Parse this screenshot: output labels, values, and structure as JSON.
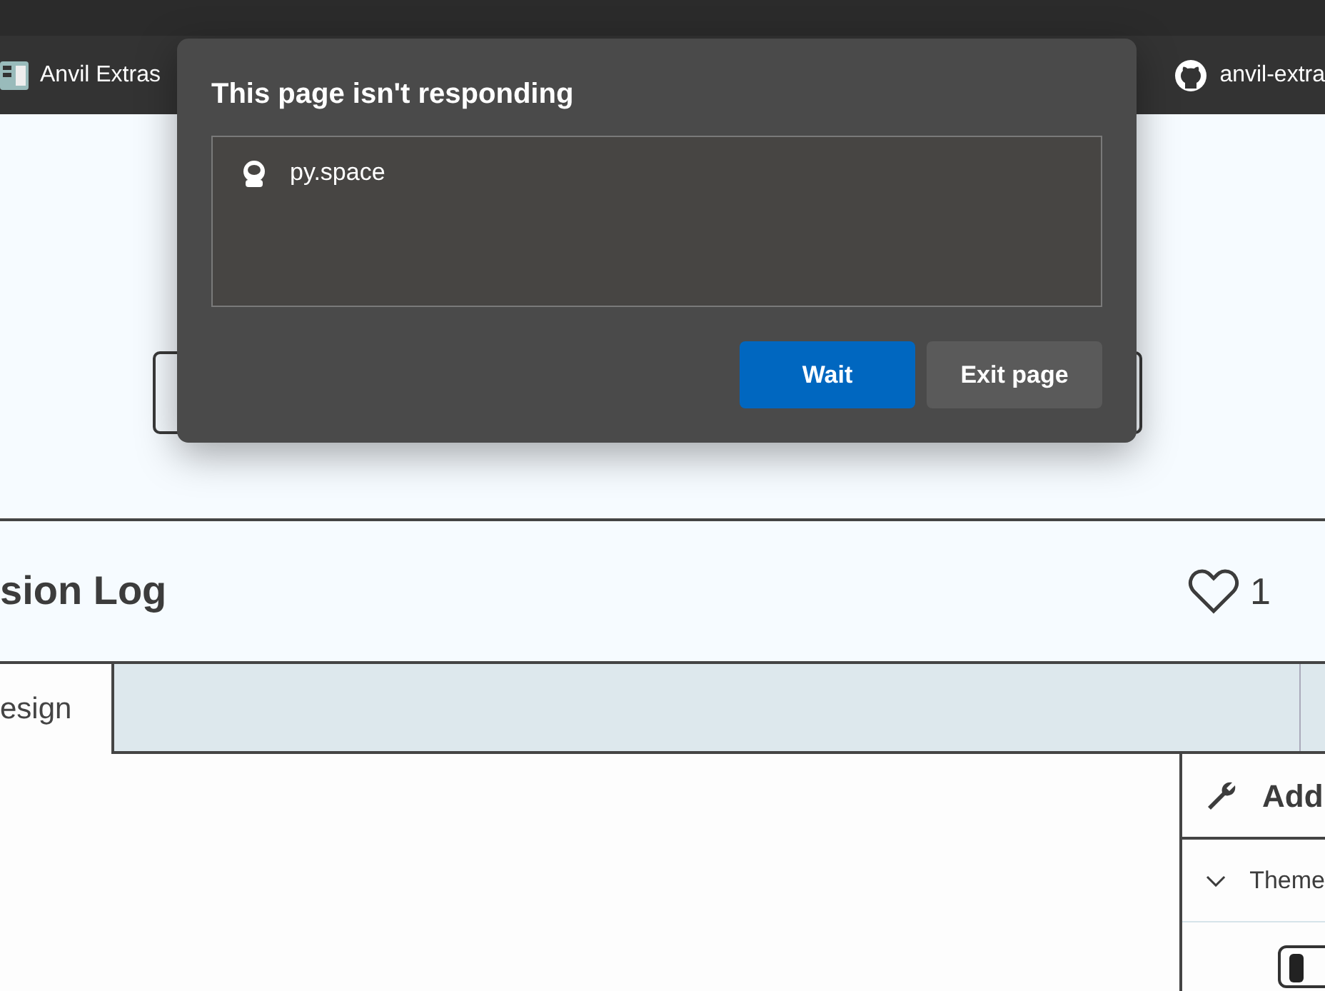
{
  "browser": {
    "bookmarks": [
      {
        "label": "Anvil Extras",
        "kind": "app"
      },
      {
        "label": "anvil-extra",
        "kind": "github"
      }
    ]
  },
  "dialog": {
    "title": "This page isn't responding",
    "site": "py.space",
    "buttons": [
      {
        "label": "Wait",
        "kind": "primary"
      },
      {
        "label": "Exit page",
        "kind": "secondary"
      }
    ]
  },
  "page": {
    "title": "sion Log",
    "like_count": "1",
    "tabs": [
      {
        "label": "esign",
        "selected": true
      }
    ],
    "panel": {
      "title": "Add",
      "sections": [
        {
          "label": "Theme",
          "expanded": true
        }
      ]
    }
  }
}
